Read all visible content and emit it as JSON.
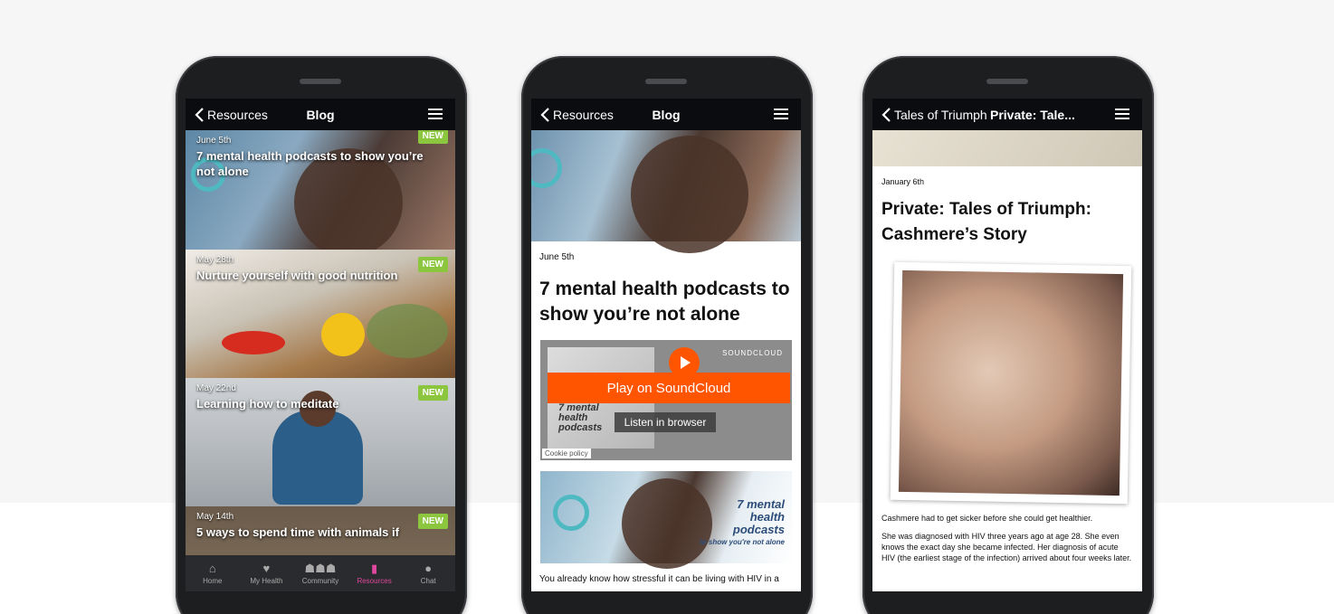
{
  "phone1": {
    "back_label": "Resources",
    "title": "Blog",
    "posts": [
      {
        "date": "June 5th",
        "title": "7 mental health podcasts to show you’re not alone",
        "badge": "NEW"
      },
      {
        "date": "May 28th",
        "title": "Nurture yourself with good nutrition",
        "badge": "NEW"
      },
      {
        "date": "May 22nd",
        "title": "Learning how to meditate",
        "badge": "NEW"
      },
      {
        "date": "May 14th",
        "title": "5 ways to spend time with animals if",
        "badge": "NEW"
      }
    ],
    "tabs": [
      {
        "label": "Home",
        "icon": "home-icon"
      },
      {
        "label": "My Health",
        "icon": "heart-icon"
      },
      {
        "label": "Community",
        "icon": "people-icon"
      },
      {
        "label": "Resources",
        "icon": "book-icon",
        "active": true
      },
      {
        "label": "Chat",
        "icon": "chat-icon"
      }
    ],
    "active_color": "#e0479e"
  },
  "phone2": {
    "back_label": "Resources",
    "title": "Blog",
    "date": "June 5th",
    "article_title": "7 mental health podcasts to show you’re not alone",
    "player": {
      "brand": "SOUNDCLOUD",
      "play_label": "Play on SoundCloud",
      "browser_label": "Listen in browser",
      "cookie_label": "Cookie policy",
      "thumb_text": "7 mental health podcasts",
      "brand_color": "#ff5500"
    },
    "image_text": [
      "7 mental",
      "health",
      "podcasts",
      "to show you're not alone"
    ],
    "body": "You already know how stressful it can be living with HIV in a"
  },
  "phone3": {
    "back_label": "Tales of Triumph",
    "title": "Private: Tale...",
    "date": "January 6th",
    "story_title": "Private: Tales of Triumph: Cashmere’s Story",
    "paragraphs": [
      "Cashmere had to get sicker before she could get healthier.",
      "She was diagnosed with HIV three years ago at age 28. She even knows the exact day she became infected. Her diagnosis of acute HIV (the earliest stage of the infection) arrived about four weeks later."
    ]
  }
}
